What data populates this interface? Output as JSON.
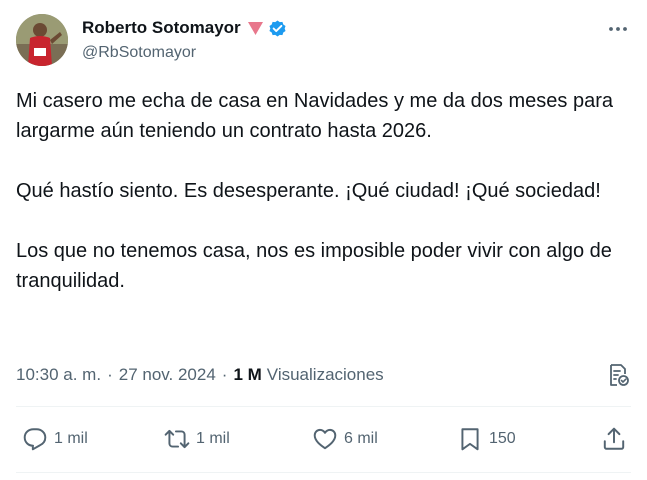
{
  "author": {
    "name": "Roberto Sotomayor",
    "handle": "@RbSotomayor",
    "avatar_icon": "runner-photo-avatar",
    "flag_icon": "pink-triangle-flag-icon",
    "verified_icon": "verified-badge-icon"
  },
  "tweet": {
    "paragraphs": [
      "Mi casero me echa de casa en Navidades y me da dos meses para largarme aún teniendo un contrato hasta 2026.",
      "Qué hastío siento. Es desesperante. ¡Qué ciudad! ¡Qué sociedad!",
      "Los que no tenemos casa, nos es imposible poder vivir con algo de tranquilidad."
    ]
  },
  "meta": {
    "time": "10:30 a. m.",
    "separator": "·",
    "date": "27 nov. 2024",
    "views_count": "1 M",
    "views_label": "Visualizaciones"
  },
  "actions": {
    "reply_count": "1 mil",
    "retweet_count": "1 mil",
    "like_count": "6 mil",
    "bookmark_count": "150"
  },
  "colors": {
    "text_primary": "#0f1419",
    "text_secondary": "#536471",
    "verified_blue": "#1d9bf0",
    "flag_pink": "#e8778c",
    "divider": "#eff3f4"
  }
}
